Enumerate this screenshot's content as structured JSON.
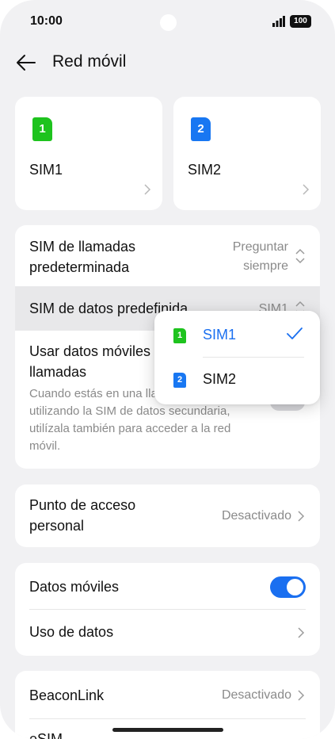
{
  "status_bar": {
    "time": "10:00",
    "battery": "100"
  },
  "header": {
    "title": "Red móvil"
  },
  "sim_cards": [
    {
      "badge": "1",
      "name": "SIM1",
      "color": "#1ec31e"
    },
    {
      "badge": "2",
      "name": "SIM2",
      "color": "#1877f2"
    }
  ],
  "sim_settings": {
    "calls_sim": {
      "label_line1": "SIM de llamadas",
      "label_line2": "predeterminada",
      "value_line1": "Preguntar",
      "value_line2": "siempre"
    },
    "data_sim": {
      "label": "SIM de datos predefinida",
      "value": "SIM1"
    },
    "mobile_data_calls": {
      "label_line1": "Usar datos móviles durante las",
      "label_line2": "llamadas",
      "desc_line1": "Cuando estás en una llamada",
      "desc_line2": "utilizando la SIM de datos secundaria,",
      "desc_line3": "utilízala también para acceder a la red",
      "desc_line4": "móvil."
    }
  },
  "hotspot": {
    "label_line1": "Punto de acceso",
    "label_line2": "personal",
    "value": "Desactivado"
  },
  "data": {
    "mobile_data_label": "Datos móviles",
    "mobile_data_on": true,
    "usage_label": "Uso de datos"
  },
  "beacon": {
    "label": "BeaconLink",
    "value": "Desactivado",
    "esim_label": "eSIM"
  },
  "dropdown": {
    "options": [
      {
        "badge": "1",
        "label": "SIM1",
        "selected": true
      },
      {
        "badge": "2",
        "label": "SIM2",
        "selected": false
      }
    ]
  },
  "colors": {
    "accent": "#1a6ff0",
    "sim1": "#1ec31e",
    "sim2": "#1877f2"
  }
}
